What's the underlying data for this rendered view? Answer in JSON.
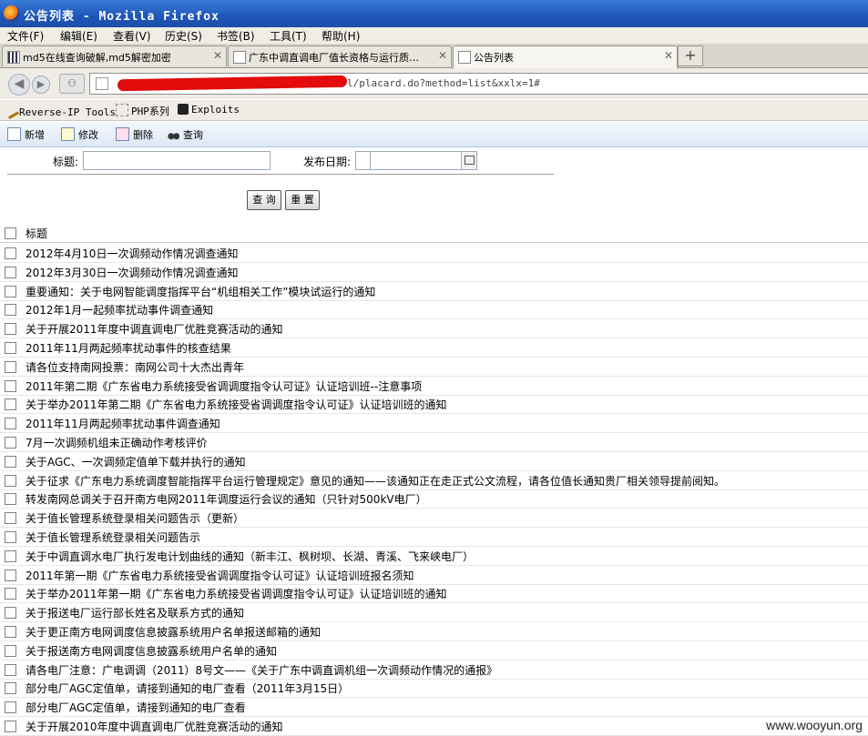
{
  "window": {
    "title": "公告列表 - Mozilla Firefox"
  },
  "menu": [
    "文件(F)",
    "编辑(E)",
    "查看(V)",
    "历史(S)",
    "书签(B)",
    "工具(T)",
    "帮助(H)"
  ],
  "tabs": [
    {
      "label": "md5在线查询破解,md5解密加密",
      "close": "✕"
    },
    {
      "label": "广东中调直调电厂值长资格与运行质…",
      "close": "✕"
    },
    {
      "label": "公告列表",
      "close": "✕"
    }
  ],
  "newtab": "+",
  "nav": {
    "back": "◀",
    "forward": "▶",
    "url_visible": "l/placard.do?method=list&xxlx=1#"
  },
  "bookmarks": [
    "Reverse-IP Tools",
    "PHP系列",
    "Exploits"
  ],
  "toolbar": [
    "新增",
    "修改",
    "删除",
    "查询"
  ],
  "form": {
    "title_label": "标题:",
    "date_label": "发布日期:",
    "query_button": "查 询",
    "reset_button": "重 置"
  },
  "list": {
    "header": "标题",
    "rows": [
      "2012年4月10日一次调频动作情况调查通知",
      "2012年3月30日一次调频动作情况调查通知",
      "重要通知：关于电网智能调度指挥平台“机组相关工作”模块试运行的通知",
      "2012年1月一起频率扰动事件调查通知",
      "关于开展2011年度中调直调电厂优胜竞赛活动的通知",
      "2011年11月两起频率扰动事件的核查结果",
      "请各位支持南网投票：南网公司十大杰出青年",
      "2011年第二期《广东省电力系统接受省调调度指令认可证》认证培训班--注意事项",
      "关于举办2011年第二期《广东省电力系统接受省调调度指令认可证》认证培训班的通知",
      "2011年11月两起频率扰动事件调查通知",
      "7月一次调频机组未正确动作考核评价",
      "关于AGC、一次调频定值单下载并执行的通知",
      "关于征求《广东电力系统调度智能指挥平台运行管理规定》意见的通知——该通知正在走正式公文流程，请各位值长通知贵厂相关领导提前阅知。",
      "转发南网总调关于召开南方电网2011年调度运行会议的通知（只针对500kV电厂）",
      "关于值长管理系统登录相关问题告示（更新）",
      "关于值长管理系统登录相关问题告示",
      "关于中调直调水电厂执行发电计划曲线的通知（新丰江、枫树坝、长湖、青溪、飞来峡电厂）",
      "2011年第一期《广东省电力系统接受省调调度指令认可证》认证培训班报名须知",
      "关于举办2011年第一期《广东省电力系统接受省调调度指令认可证》认证培训班的通知",
      "关于报送电厂运行部长姓名及联系方式的通知",
      "关于更正南方电网调度信息披露系统用户名单报送邮箱的通知",
      "关于报送南方电网调度信息披露系统用户名单的通知",
      "请各电厂注意：广电调调（2011）8号文——《关于广东中调直调机组一次调频动作情况的通报》",
      "部分电厂AGC定值单，请接到通知的电厂查看（2011年3月15日）",
      "部分电厂AGC定值单，请接到通知的电厂查看",
      "关于开展2010年度中调直调电厂优胜竞赛活动的通知"
    ]
  },
  "watermark": "www.wooyun.org"
}
